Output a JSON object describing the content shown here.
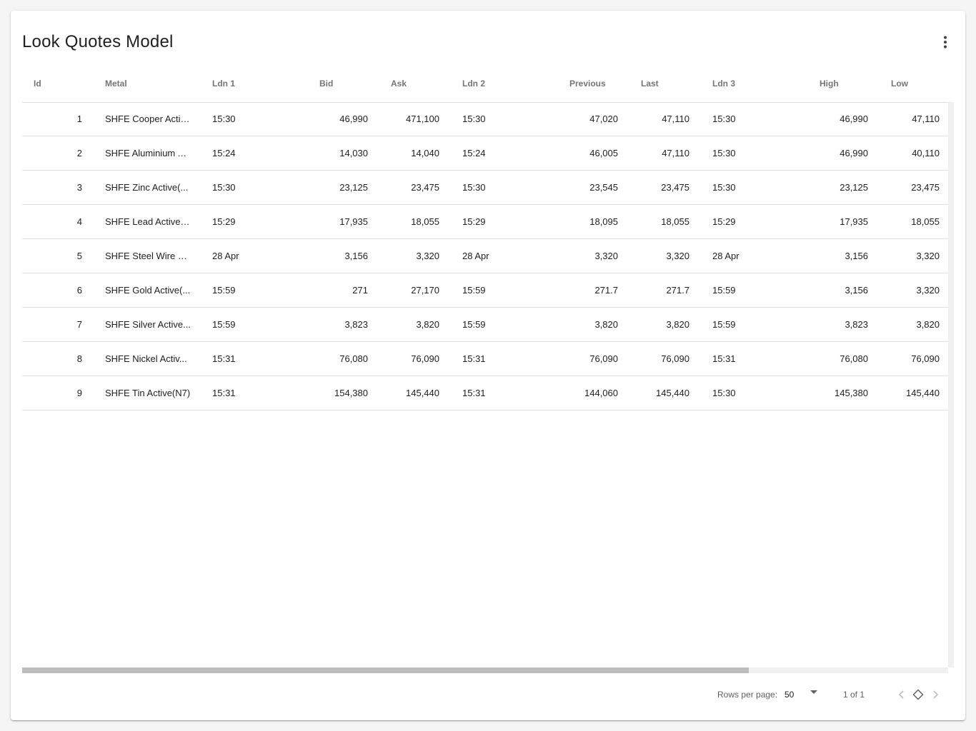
{
  "title": "Look Quotes Model",
  "menu_icon": "more-vert-icon",
  "columns": [
    "Id",
    "Metal",
    "Ldn 1",
    "Bid",
    "Ask",
    "Ldn 2",
    "Previous",
    "Last",
    "Ldn 3",
    "High",
    "Low"
  ],
  "rows": [
    {
      "id": "1",
      "metal": "SHFE Cooper Activ...",
      "ldn1": "15:30",
      "bid": "46,990",
      "ask": "471,100",
      "ldn2": "15:30",
      "previous": "47,020",
      "last": "47,110",
      "ldn3": "15:30",
      "high": "46,990",
      "low": "47,110"
    },
    {
      "id": "2",
      "metal": "SHFE Aluminium A...",
      "ldn1": "15:24",
      "bid": "14,030",
      "ask": "14,040",
      "ldn2": "15:24",
      "previous": "46,005",
      "last": "47,110",
      "ldn3": "15:30",
      "high": "46,990",
      "low": "40,110"
    },
    {
      "id": "3",
      "metal": "SHFE Zinc Active(...",
      "ldn1": "15:30",
      "bid": "23,125",
      "ask": "23,475",
      "ldn2": "15:30",
      "previous": "23,545",
      "last": "23,475",
      "ldn3": "15:30",
      "high": "23,125",
      "low": "23,475"
    },
    {
      "id": "4",
      "metal": "SHFE Lead Active(...",
      "ldn1": "15:29",
      "bid": "17,935",
      "ask": "18,055",
      "ldn2": "15:29",
      "previous": "18,095",
      "last": "18,055",
      "ldn3": "15:29",
      "high": "17,935",
      "low": "18,055"
    },
    {
      "id": "5",
      "metal": "SHFE Steel Wire R...",
      "ldn1": "28 Apr",
      "bid": "3,156",
      "ask": "3,320",
      "ldn2": "28 Apr",
      "previous": "3,320",
      "last": "3,320",
      "ldn3": "28 Apr",
      "high": "3,156",
      "low": "3,320"
    },
    {
      "id": "6",
      "metal": "SHFE Gold Active(...",
      "ldn1": "15:59",
      "bid": "271",
      "ask": "27,170",
      "ldn2": "15:59",
      "previous": "271.7",
      "last": "271.7",
      "ldn3": "15:59",
      "high": "3,156",
      "low": "3,320"
    },
    {
      "id": "7",
      "metal": "SHFE Silver Active...",
      "ldn1": "15:59",
      "bid": "3,823",
      "ask": "3,820",
      "ldn2": "15:59",
      "previous": "3,820",
      "last": "3,820",
      "ldn3": "15:59",
      "high": "3,823",
      "low": "3,820"
    },
    {
      "id": "8",
      "metal": "SHFE Nickel Activ...",
      "ldn1": "15:31",
      "bid": "76,080",
      "ask": "76,090",
      "ldn2": "15:31",
      "previous": "76,090",
      "last": "76,090",
      "ldn3": "15:31",
      "high": "76,080",
      "low": "76,090"
    },
    {
      "id": "9",
      "metal": "SHFE Tin Active(N7)",
      "ldn1": "15:31",
      "bid": "154,380",
      "ask": "145,440",
      "ldn2": "15:31",
      "previous": "144,060",
      "last": "145,440",
      "ldn3": "15:30",
      "high": "145,380",
      "low": "145,440"
    }
  ],
  "horizontal_scroll_fraction": 0.785,
  "footer": {
    "rows_per_page_label": "Rows per page:",
    "rows_per_page_value": "50",
    "page_info": "1 of 1"
  }
}
